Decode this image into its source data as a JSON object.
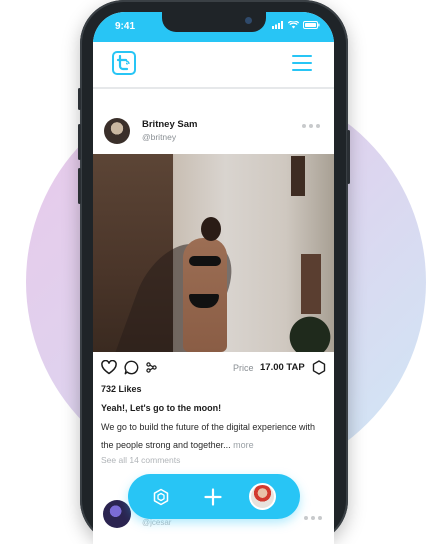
{
  "colors": {
    "accent": "#28c5f5",
    "text_muted": "#8a8f94"
  },
  "status_bar": {
    "time": "9:41"
  },
  "header": {
    "logo_icon": "t-logo-icon",
    "menu_icon": "hamburger-menu-icon"
  },
  "post": {
    "user_name": "Britney Sam",
    "user_handle": "@britney",
    "likes": "732 Likes",
    "price_label": "Price",
    "price_value": "17.00 TAP",
    "caption_title": "Yeah!, Let's go to the moon!",
    "caption_body": "We go to build the future of the digital experience with the people strong and together...",
    "caption_more": "more",
    "comments_link": "See all 14 comments"
  },
  "next_post": {
    "user_handle": "@jcesar"
  },
  "bottom_nav": {
    "items": [
      {
        "icon": "hexagon-network-icon"
      },
      {
        "icon": "plus-icon"
      },
      {
        "icon": "profile-avatar"
      }
    ]
  }
}
